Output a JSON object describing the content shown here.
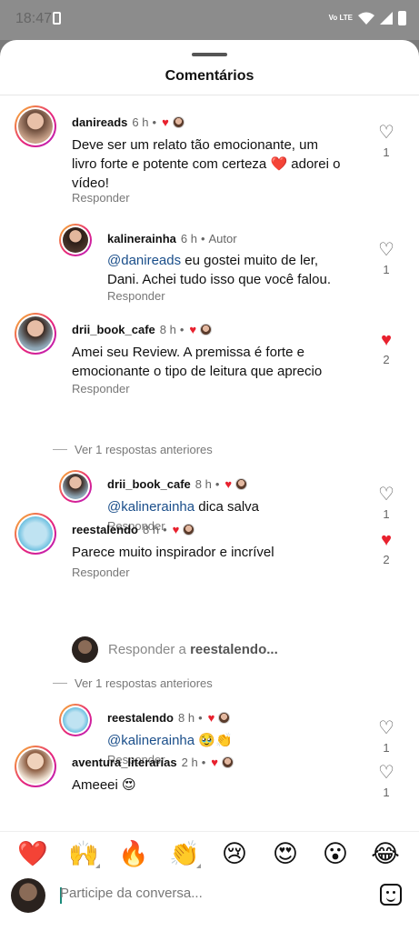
{
  "status_bar": {
    "time": "18:47",
    "network": "Vo LTE"
  },
  "sheet": {
    "title": "Comentários"
  },
  "comments": [
    {
      "username": "danireads",
      "time": "6 h",
      "text": "Deve ser um relato tão emocionante, um livro forte e potente com certeza ❤️ adorei o vídeo!",
      "reply": "Responder",
      "likes": "1",
      "liked": false
    },
    {
      "username": "kalinerainha",
      "time": "6 h",
      "tag": "Autor",
      "mention": "@danireads",
      "text": " eu gostei muito de ler, Dani. Achei tudo isso que você falou.",
      "reply": "Responder",
      "likes": "1",
      "liked": false
    },
    {
      "username": "drii_book_cafe",
      "time": "8 h",
      "text": "Amei seu Review. A premissa é forte e emocionante o tipo de leitura que aprecio",
      "reply": "Responder",
      "likes": "2",
      "liked": true
    },
    {
      "username": "drii_book_cafe",
      "time": "8 h",
      "mention": "@kalinerainha",
      "text": " dica salva",
      "reply": "Responder",
      "likes": "1",
      "liked": false
    },
    {
      "username": "reestalendo",
      "time": "8 h",
      "text": "Parece muito inspirador e incrível",
      "reply": "Responder",
      "likes": "2",
      "liked": true
    },
    {
      "username": "reestalendo",
      "time": "8 h",
      "mention": "@kalinerainha",
      "text": " 🥹👏",
      "reply": "Responder",
      "likes": "1",
      "liked": false
    },
    {
      "username": "aventura_literarias",
      "time": "2 h",
      "text": "Ameeei 😍",
      "likes": "1",
      "liked": false
    }
  ],
  "previous_replies": [
    "Ver 1 respostas anteriores",
    "Ver 1 respostas anteriores"
  ],
  "reply_prompt": {
    "prefix": "Responder a ",
    "target": "reestalendo..."
  },
  "emoji_bar": [
    "❤️",
    "🙌",
    "🔥",
    "👏",
    "😢",
    "😍",
    "😮",
    "😂"
  ],
  "compose": {
    "placeholder": "Participe da conversa..."
  },
  "colors": {
    "like_red": "#e8212e",
    "mention_blue": "#1a4e8a",
    "story_ring": "#e7247a"
  },
  "icons": {
    "like": "heart-icon",
    "sticker": "sticker-icon",
    "back": "back-icon",
    "home": "home-icon",
    "recents": "recents-icon"
  }
}
